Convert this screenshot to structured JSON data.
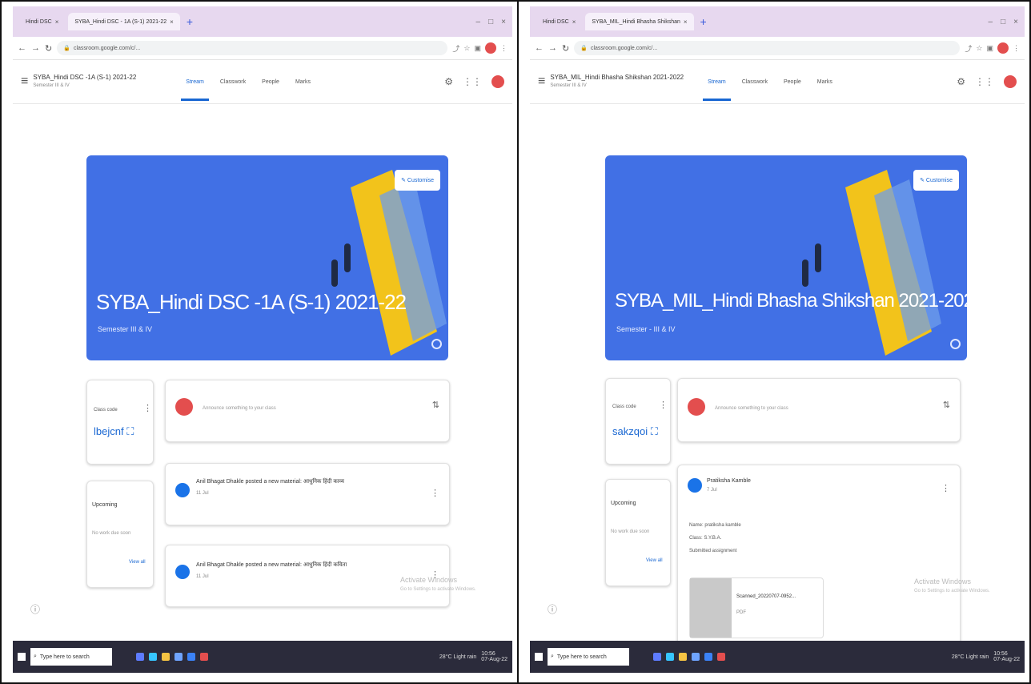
{
  "panels": [
    {
      "browser_tabs": [
        "Hindi DSC",
        "SYBA_Hindi DSC - 1A (S-1) 2021-22"
      ],
      "url": "classroom.google.com/c/...",
      "class_header": {
        "title": "SYBA_Hindi DSC -1A (S-1) 2021-22",
        "sub": "Semester III & IV"
      },
      "nav_tabs": [
        "Stream",
        "Classwork",
        "People",
        "Marks"
      ],
      "banner": {
        "title": "SYBA_Hindi DSC -1A (S-1) 2021-22",
        "subtitle": "Semester III & IV",
        "customise": "Customise"
      },
      "class_code": {
        "label": "Class code",
        "code": "lbejcnf"
      },
      "announce_placeholder": "Announce something to your class",
      "upcoming": {
        "label": "Upcoming",
        "text": "No work due soon",
        "view_all": "View all"
      },
      "posts": [
        {
          "text": "Anil Bhagat Dhakle posted a new material: आधुनिक हिंदी काव्य",
          "date": "11 Jul"
        },
        {
          "text": "Anil Bhagat Dhakle posted a new material: आधुनिक हिंदी कविता",
          "date": "11 Jul"
        }
      ],
      "watermark": [
        "Activate Windows",
        "Go to Settings to activate Windows."
      ]
    },
    {
      "browser_tabs": [
        "Hindi DSC",
        "SYBA_MIL_Hindi Bhasha Shikshan"
      ],
      "url": "classroom.google.com/c/...",
      "class_header": {
        "title": "SYBA_MIL_Hindi Bhasha Shikshan 2021-2022",
        "sub": "Semester III & IV"
      },
      "nav_tabs": [
        "Stream",
        "Classwork",
        "People",
        "Marks"
      ],
      "banner": {
        "title": "SYBA_MIL_Hindi Bhasha Shikshan 2021-2022",
        "subtitle": "Semester - III & IV",
        "customise": "Customise"
      },
      "class_code": {
        "label": "Class code",
        "code": "sakzqoi"
      },
      "announce_placeholder": "Announce something to your class",
      "upcoming": {
        "label": "Upcoming",
        "text": "No work due soon",
        "view_all": "View all"
      },
      "post": {
        "author": "Pratiksha Kamble",
        "date": "7 Jul",
        "lines": [
          "Name: pratiksha kamble",
          "Class: S.Y.B.A.",
          "Submitted assignment"
        ],
        "attachment": {
          "name": "Scanned_20220707-0952...",
          "type": "PDF"
        }
      },
      "watermark": [
        "Activate Windows",
        "Go to Settings to activate Windows."
      ]
    }
  ],
  "taskbar": {
    "search_placeholder": "Type here to search",
    "weather": "28°C Light rain",
    "time": "10:56",
    "date": "07-Aug-22"
  },
  "colors": {
    "banner": "#4170e5",
    "accent": "#1967d2"
  }
}
